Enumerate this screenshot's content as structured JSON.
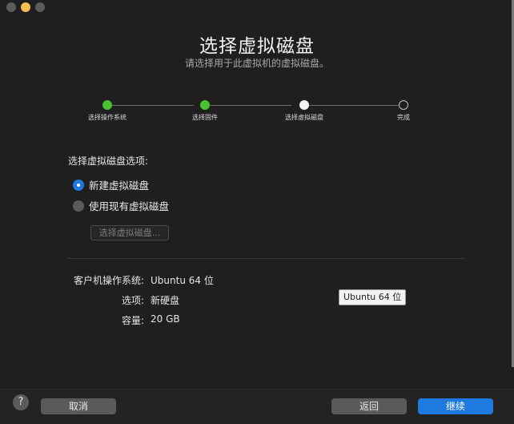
{
  "window": {
    "title": "选择虚拟磁盘",
    "subtitle": "请选择用于此虚拟机的虚拟磁盘。"
  },
  "steps": [
    {
      "label": "选择操作系统",
      "state": "done"
    },
    {
      "label": "选择固件",
      "state": "done"
    },
    {
      "label": "选择虚拟磁盘",
      "state": "current"
    },
    {
      "label": "完成",
      "state": "todo"
    }
  ],
  "disk_options": {
    "heading": "选择虚拟磁盘选项:",
    "new_disk_label": "新建虚拟磁盘",
    "existing_disk_label": "使用现有虚拟磁盘",
    "selected": "new_disk",
    "choose_button": "选择虚拟磁盘..."
  },
  "summary": {
    "os_label": "客户机操作系统:",
    "os_value": "Ubuntu 64 位",
    "option_label": "选项:",
    "option_value": "新硬盘",
    "capacity_label": "容量:",
    "capacity_value": "20 GB"
  },
  "tooltip": "Ubuntu 64 位",
  "footer": {
    "help": "?",
    "cancel": "取消",
    "back": "返回",
    "continue": "继续"
  },
  "colors": {
    "accent": "#1f7ae0",
    "step_done": "#4bc134"
  }
}
